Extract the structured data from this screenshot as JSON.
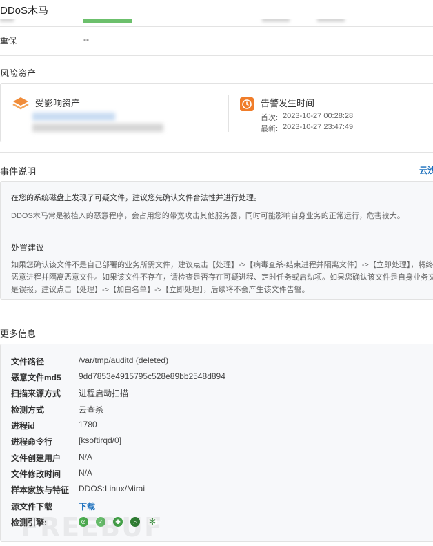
{
  "header": {
    "title": "DDoS木马"
  },
  "key_insurance": {
    "label": "重保",
    "value": "--"
  },
  "risk_assets": {
    "section_title": "风险资产",
    "affected_label": "受影响资产",
    "alert_time_label": "告警发生时间",
    "first_label": "首次:",
    "first_value": "2023-10-27 00:28:28",
    "latest_label": "最新:",
    "latest_value": "2023-10-27 23:47:49"
  },
  "event_description": {
    "section_title": "事件说明",
    "link_text": "云沙",
    "summary": "在您的系统磁盘上发现了可疑文件，建议您先确认文件合法性并进行处理。",
    "detail": "DDOS木马常是被植入的恶意程序，会占用您的带宽攻击其他服务器，同时可能影响自身业务的正常运行，危害较大。",
    "advice_title": "处置建议",
    "advice_lines": [
      "如果您确认该文件不是自己部署的业务所需文件，建议点击【处理】->【病毒查杀-结束进程并隔离文件】->【立即处理】，将终",
      "恶意进程并隔离恶意文件。如果该文件不存在，请检查是否存在可疑进程、定时任务或启动项。如果您确认该文件是自身业务文件",
      "是误报，建议点击【处理】->【加白名单】->【立即处理】，后续将不会产生该文件告警。"
    ]
  },
  "more_info": {
    "section_title": "更多信息",
    "rows": [
      {
        "label": "文件路径",
        "value": "/var/tmp/auditd (deleted)"
      },
      {
        "label": "恶意文件md5",
        "value": "9dd7853e4915795c528e89bb2548d894"
      },
      {
        "label": "扫描来源方式",
        "value": "进程启动扫描"
      },
      {
        "label": "检测方式",
        "value": "云查杀"
      },
      {
        "label": "进程id",
        "value": "1780"
      },
      {
        "label": "进程命令行",
        "value": "[ksoftirqd/0]"
      },
      {
        "label": "文件创建用户",
        "value": "N/A"
      },
      {
        "label": "文件修改时间",
        "value": "N/A"
      },
      {
        "label": "样本家族与特征",
        "value": "DDOS:Linux/Mirai"
      }
    ],
    "download_label": "源文件下载",
    "download_link": "下载",
    "engines_label": "检测引擎:",
    "engines": [
      "engine-icon-1",
      "engine-icon-2",
      "engine-icon-3",
      "engine-icon-4",
      "engine-icon-5"
    ],
    "engine_colors": [
      "#4caf50",
      "#66bb6a",
      "#43a047",
      "#2e7d32",
      "#388e3c"
    ]
  },
  "watermark": "FREEBUF"
}
